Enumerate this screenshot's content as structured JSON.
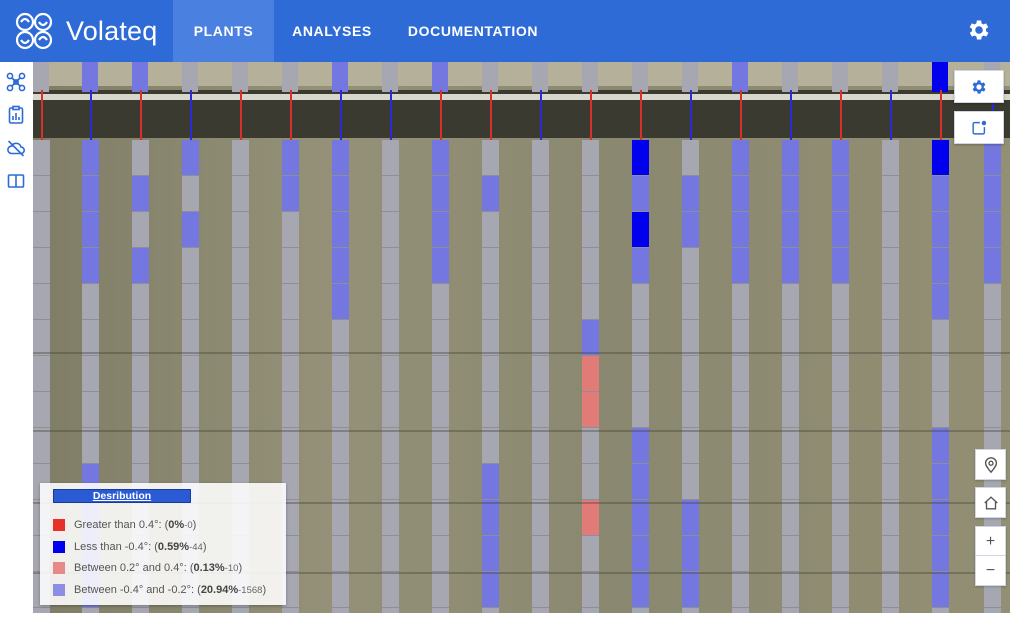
{
  "app": {
    "brand": "Volateq"
  },
  "nav": {
    "plants": "PLANTS",
    "analyses": "ANALYSES",
    "documentation": "DOCUMENTATION"
  },
  "legend": {
    "title": "Desribution",
    "rows": [
      {
        "label": "Greater than 0.4°: (",
        "percent": "0%",
        "sep": " - ",
        "count": "0",
        "close": ")",
        "color": "#e8302a"
      },
      {
        "label": "Less than -0.4°: (",
        "percent": "0.59%",
        "sep": " - ",
        "count": "44",
        "close": ")",
        "color": "#0000ee"
      },
      {
        "label": "Between 0.2° and 0.4°: (",
        "percent": "0.13%",
        "sep": " - ",
        "count": "10",
        "close": ")",
        "color": "#e58a86"
      },
      {
        "label": "Between -0.4° and -0.2°: (",
        "percent": "20.94%",
        "sep": " - ",
        "count": "1568",
        "close": ")",
        "color": "#8c8ee3"
      }
    ]
  },
  "map_controls": {
    "zoom_in": "+",
    "zoom_out": "−"
  },
  "colors": {
    "header": "#2f6bd6",
    "panel_gray": "#a6a7b1",
    "panel_blue_light": "#7477df",
    "panel_blue_dark": "#0000ee",
    "panel_red": "#e07b78"
  }
}
